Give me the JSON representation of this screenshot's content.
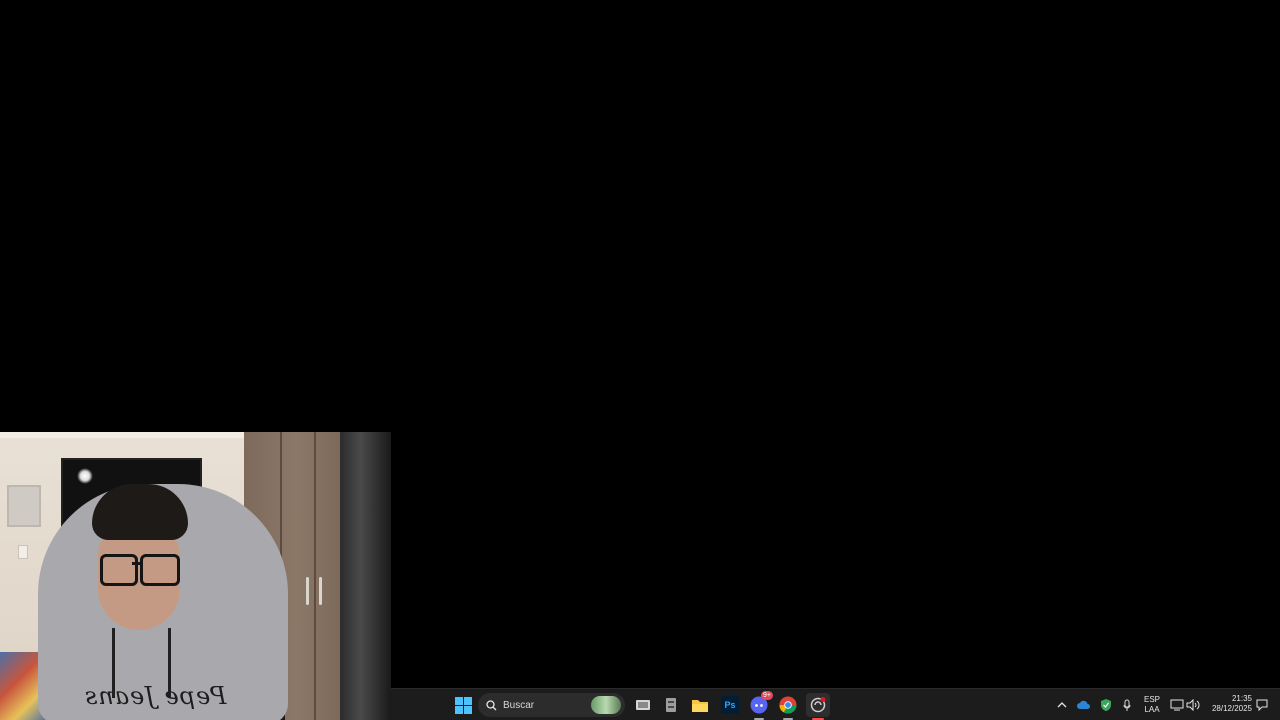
{
  "taskbar": {
    "search_placeholder": "Buscar",
    "apps": [
      {
        "name": "task-view",
        "icon": "task-view-icon"
      },
      {
        "name": "file-cabinet",
        "icon": "archive-icon"
      },
      {
        "name": "file-explorer",
        "icon": "folder-icon"
      },
      {
        "name": "photoshop",
        "label": "Ps",
        "icon": "photoshop-icon"
      },
      {
        "name": "discord",
        "icon": "discord-icon",
        "badge": "9+"
      },
      {
        "name": "chrome",
        "icon": "chrome-icon"
      },
      {
        "name": "recorder",
        "icon": "recorder-icon",
        "active": true
      }
    ],
    "language": {
      "line1": "ESP",
      "line2": "LAA"
    },
    "time": "21:35",
    "date": "28/12/2025"
  },
  "webcam": {
    "shirt_text": "Pepe Jeans"
  },
  "colors": {
    "accent": "#4cc2ff",
    "taskbar_bg": "#1c1c1c",
    "active_indicator": "#ff4b4b"
  }
}
